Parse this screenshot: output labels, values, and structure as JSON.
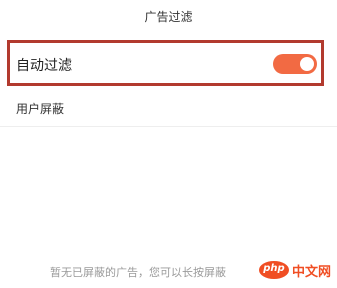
{
  "header": {
    "title": "广告过滤"
  },
  "settings": {
    "auto_filter": {
      "label": "自动过滤",
      "toggle_on": true,
      "toggle_color": "#f26a43"
    },
    "user_block": {
      "label": "用户屏蔽"
    }
  },
  "empty_state": {
    "hint": "暂无已屏蔽的广告，您可以长按屏蔽"
  },
  "watermark": {
    "logo_text": "php",
    "site_text": "中文网",
    "color": "#f04e23"
  },
  "highlight_color": "#b23a2e"
}
